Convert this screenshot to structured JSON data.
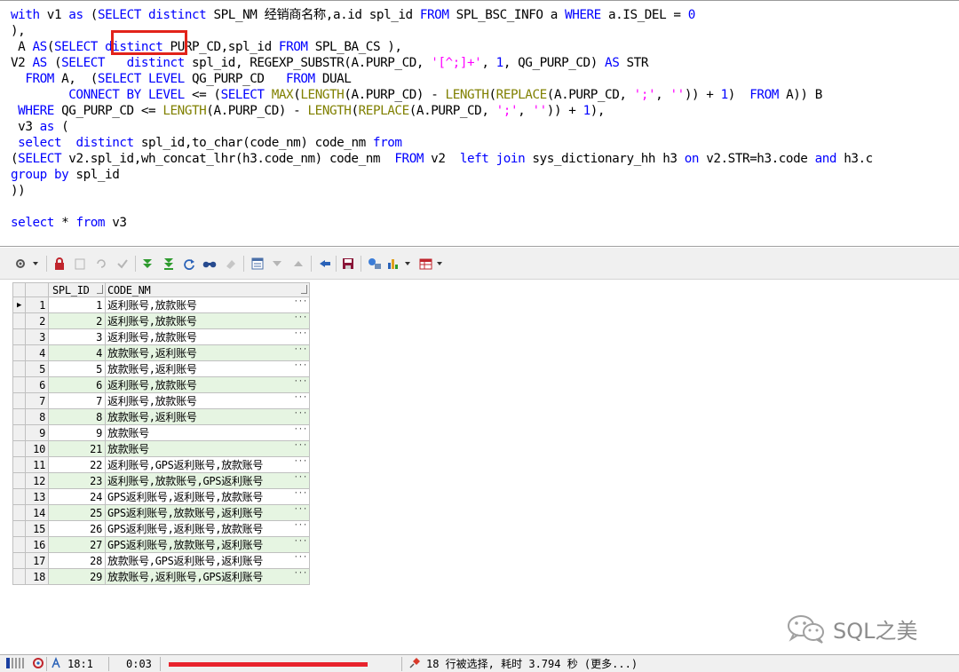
{
  "editor": {
    "lines": [
      [
        {
          "t": "with",
          "c": "kw"
        },
        {
          "t": " v1 "
        },
        {
          "t": "as",
          "c": "kw"
        },
        {
          "t": " ("
        },
        {
          "t": "SELECT distinct",
          "c": "kw"
        },
        {
          "t": " SPL_NM 经销商名称,a.id spl_id "
        },
        {
          "t": "FROM",
          "c": "kw"
        },
        {
          "t": " SPL_BSC_INFO a "
        },
        {
          "t": "WHERE",
          "c": "kw"
        },
        {
          "t": " a.IS_DEL = "
        },
        {
          "t": "0",
          "c": "kw"
        }
      ],
      [
        {
          "t": "),"
        }
      ],
      [
        {
          "t": " A "
        },
        {
          "t": "AS",
          "c": "kw"
        },
        {
          "t": "("
        },
        {
          "t": "SELECT",
          "c": "kw"
        },
        {
          "t": " "
        },
        {
          "t": "distinct",
          "c": "kw"
        },
        {
          "t": " PURP_CD,spl_id "
        },
        {
          "t": "FROM",
          "c": "kw"
        },
        {
          "t": " SPL_BA_CS ),"
        }
      ],
      [
        {
          "t": "V2 "
        },
        {
          "t": "AS",
          "c": "kw"
        },
        {
          "t": " ("
        },
        {
          "t": "SELECT",
          "c": "kw"
        },
        {
          "t": "   "
        },
        {
          "t": "distinct",
          "c": "kw"
        },
        {
          "t": " spl_id, REGEXP_SUBSTR(A.PURP_CD, "
        },
        {
          "t": "'[^;]+'",
          "c": "str"
        },
        {
          "t": ", "
        },
        {
          "t": "1",
          "c": "kw"
        },
        {
          "t": ", QG_PURP_CD) "
        },
        {
          "t": "AS",
          "c": "kw"
        },
        {
          "t": " STR"
        }
      ],
      [
        {
          "t": "  "
        },
        {
          "t": "FROM",
          "c": "kw"
        },
        {
          "t": " A,  ("
        },
        {
          "t": "SELECT LEVEL",
          "c": "kw"
        },
        {
          "t": " QG_PURP_CD   "
        },
        {
          "t": "FROM",
          "c": "kw"
        },
        {
          "t": " DUAL"
        }
      ],
      [
        {
          "t": "        "
        },
        {
          "t": "CONNECT BY LEVEL",
          "c": "kw"
        },
        {
          "t": " <= ("
        },
        {
          "t": "SELECT",
          "c": "kw"
        },
        {
          "t": " "
        },
        {
          "t": "MAX",
          "c": "fn"
        },
        {
          "t": "("
        },
        {
          "t": "LENGTH",
          "c": "fn"
        },
        {
          "t": "(A.PURP_CD) - "
        },
        {
          "t": "LENGTH",
          "c": "fn"
        },
        {
          "t": "("
        },
        {
          "t": "REPLACE",
          "c": "fn"
        },
        {
          "t": "(A.PURP_CD, "
        },
        {
          "t": "';'",
          "c": "str"
        },
        {
          "t": ", "
        },
        {
          "t": "''",
          "c": "str"
        },
        {
          "t": ")) + "
        },
        {
          "t": "1",
          "c": "kw"
        },
        {
          "t": ")  "
        },
        {
          "t": "FROM",
          "c": "kw"
        },
        {
          "t": " A)) B"
        }
      ],
      [
        {
          "t": " "
        },
        {
          "t": "WHERE",
          "c": "kw"
        },
        {
          "t": " QG_PURP_CD <= "
        },
        {
          "t": "LENGTH",
          "c": "fn"
        },
        {
          "t": "(A.PURP_CD) - "
        },
        {
          "t": "LENGTH",
          "c": "fn"
        },
        {
          "t": "("
        },
        {
          "t": "REPLACE",
          "c": "fn"
        },
        {
          "t": "(A.PURP_CD, "
        },
        {
          "t": "';'",
          "c": "str"
        },
        {
          "t": ", "
        },
        {
          "t": "''",
          "c": "str"
        },
        {
          "t": ")) + "
        },
        {
          "t": "1",
          "c": "kw"
        },
        {
          "t": "),"
        }
      ],
      [
        {
          "t": " v3 "
        },
        {
          "t": "as",
          "c": "kw"
        },
        {
          "t": " ("
        }
      ],
      [
        {
          "t": " "
        },
        {
          "t": "select",
          "c": "kw"
        },
        {
          "t": "  "
        },
        {
          "t": "distinct",
          "c": "kw"
        },
        {
          "t": " spl_id,to_char(code_nm) code_nm "
        },
        {
          "t": "from",
          "c": "kw"
        }
      ],
      [
        {
          "t": "("
        },
        {
          "t": "SELECT",
          "c": "kw"
        },
        {
          "t": " v2.spl_id,wh_concat_lhr(h3.code_nm) code_nm  "
        },
        {
          "t": "FROM",
          "c": "kw"
        },
        {
          "t": " v2  "
        },
        {
          "t": "left join",
          "c": "kw"
        },
        {
          "t": " sys_dictionary_hh h3 "
        },
        {
          "t": "on",
          "c": "kw"
        },
        {
          "t": " v2.STR=h3.code "
        },
        {
          "t": "and",
          "c": "kw"
        },
        {
          "t": " h3.c"
        }
      ],
      [
        {
          "t": "group by",
          "c": "kw"
        },
        {
          "t": " spl_id"
        }
      ],
      [
        {
          "t": "))"
        }
      ],
      [
        {
          "t": ""
        }
      ],
      [
        {
          "t": "select",
          "c": "kw"
        },
        {
          "t": " * "
        },
        {
          "t": "from",
          "c": "kw"
        },
        {
          "t": " v3"
        }
      ]
    ]
  },
  "grid": {
    "columns": [
      "SPL_ID",
      "CODE_NM"
    ],
    "rows": [
      {
        "n": "1",
        "id": "1",
        "nm": "返利账号,放款账号"
      },
      {
        "n": "2",
        "id": "2",
        "nm": "返利账号,放款账号"
      },
      {
        "n": "3",
        "id": "3",
        "nm": "返利账号,放款账号"
      },
      {
        "n": "4",
        "id": "4",
        "nm": "放款账号,返利账号"
      },
      {
        "n": "5",
        "id": "5",
        "nm": "放款账号,返利账号"
      },
      {
        "n": "6",
        "id": "6",
        "nm": "返利账号,放款账号"
      },
      {
        "n": "7",
        "id": "7",
        "nm": "返利账号,放款账号"
      },
      {
        "n": "8",
        "id": "8",
        "nm": "放款账号,返利账号"
      },
      {
        "n": "9",
        "id": "9",
        "nm": "放款账号"
      },
      {
        "n": "10",
        "id": "21",
        "nm": "放款账号"
      },
      {
        "n": "11",
        "id": "22",
        "nm": "返利账号,GPS返利账号,放款账号"
      },
      {
        "n": "12",
        "id": "23",
        "nm": "返利账号,放款账号,GPS返利账号"
      },
      {
        "n": "13",
        "id": "24",
        "nm": "GPS返利账号,返利账号,放款账号"
      },
      {
        "n": "14",
        "id": "25",
        "nm": "GPS返利账号,放款账号,返利账号"
      },
      {
        "n": "15",
        "id": "26",
        "nm": "GPS返利账号,返利账号,放款账号"
      },
      {
        "n": "16",
        "id": "27",
        "nm": "GPS返利账号,放款账号,返利账号"
      },
      {
        "n": "17",
        "id": "28",
        "nm": "放款账号,GPS返利账号,返利账号"
      },
      {
        "n": "18",
        "id": "29",
        "nm": "放款账号,返利账号,GPS返利账号"
      }
    ],
    "cell_ellipsis": "···",
    "current_row_marker": "▶"
  },
  "status": {
    "cursor": "18:1",
    "elapsed": "0:03",
    "message": "18 行被选择, 耗时 3.794 秒 (更多...)"
  },
  "watermark": {
    "text": "SQL之美"
  },
  "colors": {
    "keyword": "#0000ff",
    "string": "#ff00ff",
    "function": "#808000",
    "highlight_box": "#e2231a",
    "grid_alt_row": "#e6f5e2",
    "redaction": "#e8232d"
  },
  "icons": [
    "settings-icon",
    "lock-icon",
    "clear-icon",
    "undo-icon",
    "check-icon",
    "fetch-next-icon",
    "fetch-last-icon",
    "refresh-icon",
    "find-icon",
    "eraser-icon",
    "query-by-example-icon",
    "filter-icon",
    "clear-filter-icon",
    "export-icon",
    "save-icon",
    "connection-icon",
    "chart-icon",
    "grid-view-icon"
  ]
}
